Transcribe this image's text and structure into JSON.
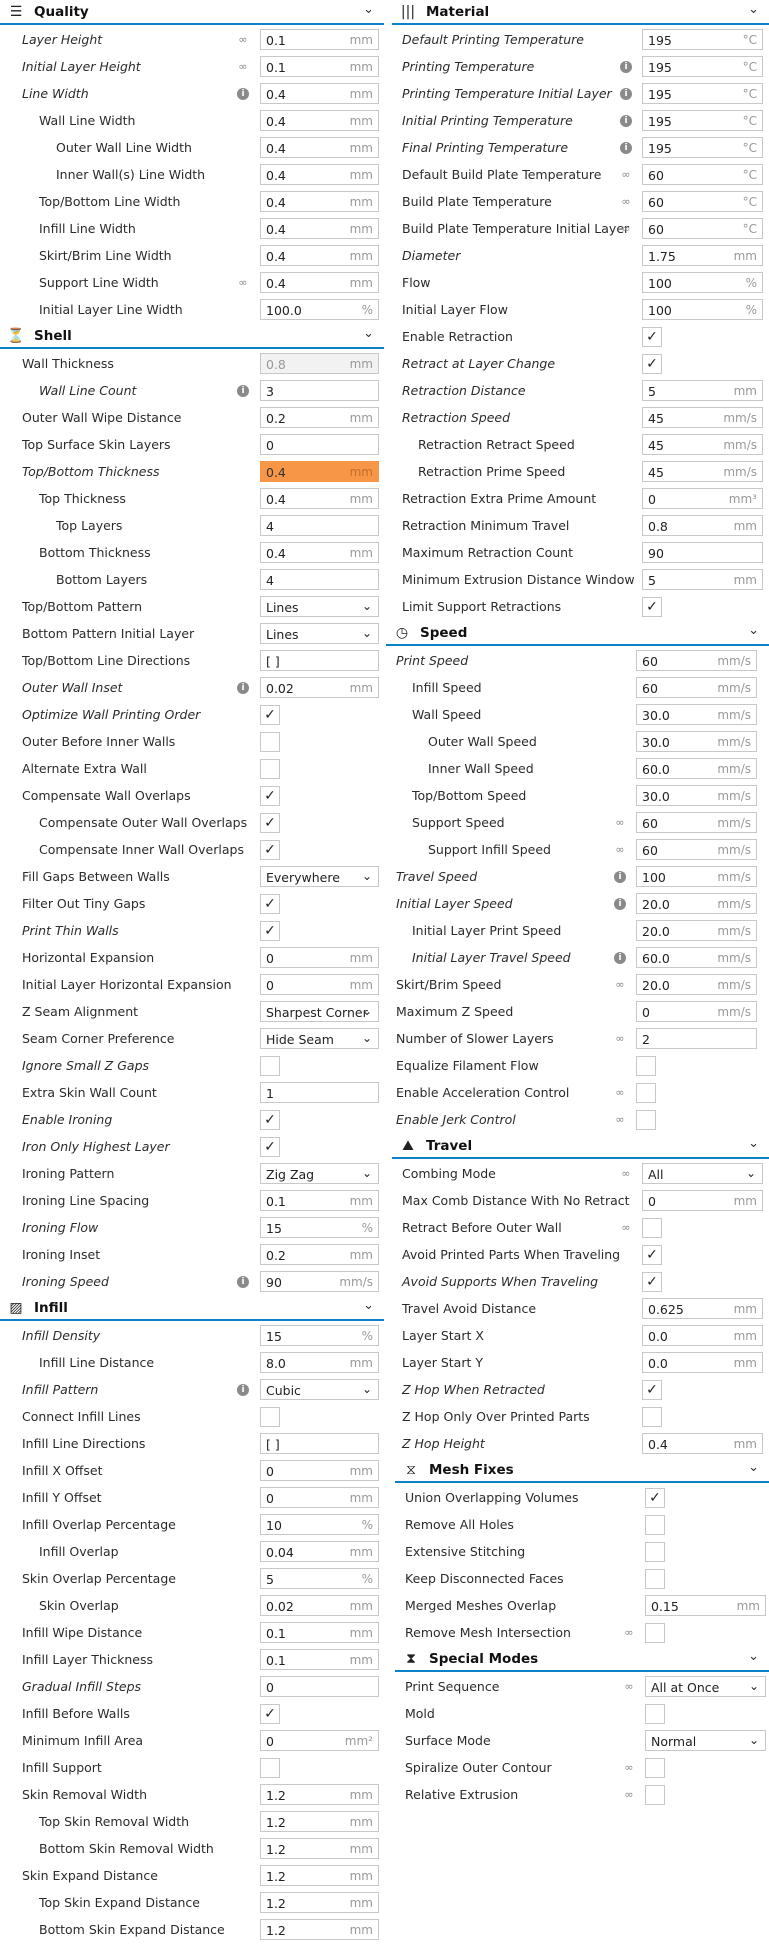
{
  "left": [
    {
      "t": "s",
      "name": "Quality",
      "icon": "quality-icon",
      "glyph": "☰"
    },
    {
      "t": "n",
      "label": "Layer Height",
      "i": 1,
      "ind": 0,
      "icon": "link",
      "val": "0.1",
      "unit": "mm"
    },
    {
      "t": "n",
      "label": "Initial Layer Height",
      "i": 1,
      "ind": 0,
      "icon": "link",
      "val": "0.1",
      "unit": "mm"
    },
    {
      "t": "n",
      "label": "Line Width",
      "i": 1,
      "ind": 0,
      "icon": "info",
      "val": "0.4",
      "unit": "mm"
    },
    {
      "t": "n",
      "label": "Wall Line Width",
      "i": 0,
      "ind": 1,
      "val": "0.4",
      "unit": "mm"
    },
    {
      "t": "n",
      "label": "Outer Wall Line Width",
      "i": 0,
      "ind": 2,
      "val": "0.4",
      "unit": "mm"
    },
    {
      "t": "n",
      "label": "Inner Wall(s) Line Width",
      "i": 0,
      "ind": 2,
      "val": "0.4",
      "unit": "mm"
    },
    {
      "t": "n",
      "label": "Top/Bottom Line Width",
      "i": 0,
      "ind": 1,
      "val": "0.4",
      "unit": "mm"
    },
    {
      "t": "n",
      "label": "Infill Line Width",
      "i": 0,
      "ind": 1,
      "val": "0.4",
      "unit": "mm"
    },
    {
      "t": "n",
      "label": "Skirt/Brim Line Width",
      "i": 0,
      "ind": 1,
      "val": "0.4",
      "unit": "mm"
    },
    {
      "t": "n",
      "label": "Support Line Width",
      "i": 0,
      "ind": 1,
      "icon": "link",
      "val": "0.4",
      "unit": "mm"
    },
    {
      "t": "n",
      "label": "Initial Layer Line Width",
      "i": 0,
      "ind": 1,
      "val": "100.0",
      "unit": "%"
    },
    {
      "t": "s",
      "name": "Shell",
      "icon": "shell-icon",
      "glyph": "⏳"
    },
    {
      "t": "n",
      "label": "Wall Thickness",
      "i": 0,
      "ind": 0,
      "val": "0.8",
      "unit": "mm",
      "st": "dis"
    },
    {
      "t": "n",
      "label": "Wall Line Count",
      "i": 1,
      "ind": 1,
      "icon": "info",
      "val": "3",
      "unit": ""
    },
    {
      "t": "n",
      "label": "Outer Wall Wipe Distance",
      "i": 0,
      "ind": 0,
      "val": "0.2",
      "unit": "mm"
    },
    {
      "t": "n",
      "label": "Top Surface Skin Layers",
      "i": 0,
      "ind": 0,
      "val": "0",
      "unit": ""
    },
    {
      "t": "n",
      "label": "Top/Bottom Thickness",
      "i": 1,
      "ind": 0,
      "val": "0.4",
      "unit": "mm",
      "st": "err"
    },
    {
      "t": "n",
      "label": "Top Thickness",
      "i": 0,
      "ind": 1,
      "val": "0.4",
      "unit": "mm"
    },
    {
      "t": "n",
      "label": "Top Layers",
      "i": 0,
      "ind": 2,
      "val": "4",
      "unit": ""
    },
    {
      "t": "n",
      "label": "Bottom Thickness",
      "i": 0,
      "ind": 1,
      "val": "0.4",
      "unit": "mm"
    },
    {
      "t": "n",
      "label": "Bottom Layers",
      "i": 0,
      "ind": 2,
      "val": "4",
      "unit": ""
    },
    {
      "t": "d",
      "label": "Top/Bottom Pattern",
      "i": 0,
      "ind": 0,
      "val": "Lines"
    },
    {
      "t": "d",
      "label": "Bottom Pattern Initial Layer",
      "i": 0,
      "ind": 0,
      "val": "Lines"
    },
    {
      "t": "n",
      "label": "Top/Bottom Line Directions",
      "i": 0,
      "ind": 0,
      "val": "[ ]",
      "unit": ""
    },
    {
      "t": "n",
      "label": "Outer Wall Inset",
      "i": 1,
      "ind": 0,
      "icon": "info",
      "val": "0.02",
      "unit": "mm"
    },
    {
      "t": "c",
      "label": "Optimize Wall Printing Order",
      "i": 1,
      "ind": 0,
      "chk": 1
    },
    {
      "t": "c",
      "label": "Outer Before Inner Walls",
      "i": 0,
      "ind": 0,
      "chk": 0
    },
    {
      "t": "c",
      "label": "Alternate Extra Wall",
      "i": 0,
      "ind": 0,
      "chk": 0
    },
    {
      "t": "c",
      "label": "Compensate Wall Overlaps",
      "i": 0,
      "ind": 0,
      "chk": 1
    },
    {
      "t": "c",
      "label": "Compensate Outer Wall Overlaps",
      "i": 0,
      "ind": 1,
      "chk": 1
    },
    {
      "t": "c",
      "label": "Compensate Inner Wall Overlaps",
      "i": 0,
      "ind": 1,
      "chk": 1
    },
    {
      "t": "d",
      "label": "Fill Gaps Between Walls",
      "i": 0,
      "ind": 0,
      "val": "Everywhere"
    },
    {
      "t": "c",
      "label": "Filter Out Tiny Gaps",
      "i": 0,
      "ind": 0,
      "chk": 1
    },
    {
      "t": "c",
      "label": "Print Thin Walls",
      "i": 1,
      "ind": 0,
      "chk": 1
    },
    {
      "t": "n",
      "label": "Horizontal Expansion",
      "i": 0,
      "ind": 0,
      "val": "0",
      "unit": "mm"
    },
    {
      "t": "n",
      "label": "Initial Layer Horizontal Expansion",
      "i": 0,
      "ind": 0,
      "val": "0",
      "unit": "mm"
    },
    {
      "t": "d",
      "label": "Z Seam Alignment",
      "i": 0,
      "ind": 0,
      "val": "Sharpest Corner"
    },
    {
      "t": "d",
      "label": "Seam Corner Preference",
      "i": 0,
      "ind": 0,
      "val": "Hide Seam"
    },
    {
      "t": "c",
      "label": "Ignore Small Z Gaps",
      "i": 1,
      "ind": 0,
      "chk": 0
    },
    {
      "t": "n",
      "label": "Extra Skin Wall Count",
      "i": 0,
      "ind": 0,
      "val": "1",
      "unit": ""
    },
    {
      "t": "c",
      "label": "Enable Ironing",
      "i": 1,
      "ind": 0,
      "chk": 1
    },
    {
      "t": "c",
      "label": "Iron Only Highest Layer",
      "i": 1,
      "ind": 0,
      "chk": 1
    },
    {
      "t": "d",
      "label": "Ironing Pattern",
      "i": 0,
      "ind": 0,
      "val": "Zig Zag"
    },
    {
      "t": "n",
      "label": "Ironing Line Spacing",
      "i": 0,
      "ind": 0,
      "val": "0.1",
      "unit": "mm"
    },
    {
      "t": "n",
      "label": "Ironing Flow",
      "i": 1,
      "ind": 0,
      "val": "15",
      "unit": "%"
    },
    {
      "t": "n",
      "label": "Ironing Inset",
      "i": 0,
      "ind": 0,
      "val": "0.2",
      "unit": "mm"
    },
    {
      "t": "n",
      "label": "Ironing Speed",
      "i": 1,
      "ind": 0,
      "icon": "info",
      "val": "90",
      "unit": "mm/s"
    },
    {
      "t": "s",
      "name": "Infill",
      "icon": "infill-icon",
      "glyph": "▨"
    },
    {
      "t": "n",
      "label": "Infill Density",
      "i": 1,
      "ind": 0,
      "val": "15",
      "unit": "%"
    },
    {
      "t": "n",
      "label": "Infill Line Distance",
      "i": 0,
      "ind": 1,
      "val": "8.0",
      "unit": "mm"
    },
    {
      "t": "d",
      "label": "Infill Pattern",
      "i": 1,
      "ind": 0,
      "icon": "info",
      "val": "Cubic"
    },
    {
      "t": "c",
      "label": "Connect Infill Lines",
      "i": 0,
      "ind": 0,
      "chk": 0
    },
    {
      "t": "n",
      "label": "Infill Line Directions",
      "i": 0,
      "ind": 0,
      "val": "[ ]",
      "unit": ""
    },
    {
      "t": "n",
      "label": "Infill X Offset",
      "i": 0,
      "ind": 0,
      "val": "0",
      "unit": "mm"
    },
    {
      "t": "n",
      "label": "Infill Y Offset",
      "i": 0,
      "ind": 0,
      "val": "0",
      "unit": "mm"
    },
    {
      "t": "n",
      "label": "Infill Overlap Percentage",
      "i": 0,
      "ind": 0,
      "val": "10",
      "unit": "%"
    },
    {
      "t": "n",
      "label": "Infill Overlap",
      "i": 0,
      "ind": 1,
      "val": "0.04",
      "unit": "mm"
    },
    {
      "t": "n",
      "label": "Skin Overlap Percentage",
      "i": 0,
      "ind": 0,
      "val": "5",
      "unit": "%"
    },
    {
      "t": "n",
      "label": "Skin Overlap",
      "i": 0,
      "ind": 1,
      "val": "0.02",
      "unit": "mm"
    },
    {
      "t": "n",
      "label": "Infill Wipe Distance",
      "i": 0,
      "ind": 0,
      "val": "0.1",
      "unit": "mm"
    },
    {
      "t": "n",
      "label": "Infill Layer Thickness",
      "i": 0,
      "ind": 0,
      "val": "0.1",
      "unit": "mm"
    },
    {
      "t": "n",
      "label": "Gradual Infill Steps",
      "i": 1,
      "ind": 0,
      "val": "0",
      "unit": ""
    },
    {
      "t": "c",
      "label": "Infill Before Walls",
      "i": 0,
      "ind": 0,
      "chk": 1
    },
    {
      "t": "n",
      "label": "Minimum Infill Area",
      "i": 0,
      "ind": 0,
      "val": "0",
      "unit": "mm²"
    },
    {
      "t": "c",
      "label": "Infill Support",
      "i": 0,
      "ind": 0,
      "chk": 0
    },
    {
      "t": "n",
      "label": "Skin Removal Width",
      "i": 0,
      "ind": 0,
      "val": "1.2",
      "unit": "mm"
    },
    {
      "t": "n",
      "label": "Top Skin Removal Width",
      "i": 0,
      "ind": 1,
      "val": "1.2",
      "unit": "mm"
    },
    {
      "t": "n",
      "label": "Bottom Skin Removal Width",
      "i": 0,
      "ind": 1,
      "val": "1.2",
      "unit": "mm"
    },
    {
      "t": "n",
      "label": "Skin Expand Distance",
      "i": 0,
      "ind": 0,
      "val": "1.2",
      "unit": "mm"
    },
    {
      "t": "n",
      "label": "Top Skin Expand Distance",
      "i": 0,
      "ind": 1,
      "val": "1.2",
      "unit": "mm"
    },
    {
      "t": "n",
      "label": "Bottom Skin Expand Distance",
      "i": 0,
      "ind": 1,
      "val": "1.2",
      "unit": "mm"
    }
  ],
  "right": [
    {
      "t": "s",
      "name": "Material",
      "icon": "material-icon",
      "glyph": "|||"
    },
    {
      "t": "n",
      "label": "Default Printing Temperature",
      "i": 1,
      "ind": 0,
      "val": "195",
      "unit": "°C"
    },
    {
      "t": "n",
      "label": "Printing Temperature",
      "i": 1,
      "ind": 0,
      "icon": "info",
      "val": "195",
      "unit": "°C"
    },
    {
      "t": "n",
      "label": "Printing Temperature Initial Layer",
      "i": 1,
      "ind": 0,
      "icon": "info",
      "val": "195",
      "unit": "°C"
    },
    {
      "t": "n",
      "label": "Initial Printing Temperature",
      "i": 1,
      "ind": 0,
      "icon": "info",
      "val": "195",
      "unit": "°C"
    },
    {
      "t": "n",
      "label": "Final Printing Temperature",
      "i": 1,
      "ind": 0,
      "icon": "info",
      "val": "195",
      "unit": "°C"
    },
    {
      "t": "n",
      "label": "Default Build Plate Temperature",
      "i": 0,
      "ind": 0,
      "icon": "link",
      "val": "60",
      "unit": "°C"
    },
    {
      "t": "n",
      "label": "Build Plate Temperature",
      "i": 0,
      "ind": 0,
      "icon": "link",
      "val": "60",
      "unit": "°C"
    },
    {
      "t": "n",
      "label": "Build Plate Temperature Initial Layer",
      "i": 0,
      "ind": 0,
      "icon": "link",
      "val": "60",
      "unit": "°C"
    },
    {
      "t": "n",
      "label": "Diameter",
      "i": 1,
      "ind": 0,
      "val": "1.75",
      "unit": "mm"
    },
    {
      "t": "n",
      "label": "Flow",
      "i": 0,
      "ind": 0,
      "val": "100",
      "unit": "%"
    },
    {
      "t": "n",
      "label": "Initial Layer Flow",
      "i": 0,
      "ind": 0,
      "val": "100",
      "unit": "%"
    },
    {
      "t": "c",
      "label": "Enable Retraction",
      "i": 0,
      "ind": 0,
      "chk": 1
    },
    {
      "t": "c",
      "label": "Retract at Layer Change",
      "i": 1,
      "ind": 0,
      "chk": 1
    },
    {
      "t": "n",
      "label": "Retraction Distance",
      "i": 1,
      "ind": 0,
      "val": "5",
      "unit": "mm"
    },
    {
      "t": "n",
      "label": "Retraction Speed",
      "i": 1,
      "ind": 0,
      "val": "45",
      "unit": "mm/s"
    },
    {
      "t": "n",
      "label": "Retraction Retract Speed",
      "i": 0,
      "ind": 1,
      "val": "45",
      "unit": "mm/s"
    },
    {
      "t": "n",
      "label": "Retraction Prime Speed",
      "i": 0,
      "ind": 1,
      "val": "45",
      "unit": "mm/s"
    },
    {
      "t": "n",
      "label": "Retraction Extra Prime Amount",
      "i": 0,
      "ind": 0,
      "val": "0",
      "unit": "mm³"
    },
    {
      "t": "n",
      "label": "Retraction Minimum Travel",
      "i": 0,
      "ind": 0,
      "val": "0.8",
      "unit": "mm"
    },
    {
      "t": "n",
      "label": "Maximum Retraction Count",
      "i": 0,
      "ind": 0,
      "val": "90",
      "unit": ""
    },
    {
      "t": "n",
      "label": "Minimum Extrusion Distance Window",
      "i": 0,
      "ind": 0,
      "val": "5",
      "unit": "mm"
    },
    {
      "t": "c",
      "label": "Limit Support Retractions",
      "i": 0,
      "ind": 0,
      "chk": 1
    },
    {
      "t": "s",
      "name": "Speed",
      "icon": "speed-icon",
      "glyph": "◷",
      "x": -6
    },
    {
      "t": "n",
      "label": "Print Speed",
      "i": 1,
      "ind": 0,
      "val": "60",
      "unit": "mm/s",
      "x": -6
    },
    {
      "t": "n",
      "label": "Infill Speed",
      "i": 0,
      "ind": 1,
      "val": "60",
      "unit": "mm/s",
      "x": -6
    },
    {
      "t": "n",
      "label": "Wall Speed",
      "i": 0,
      "ind": 1,
      "val": "30.0",
      "unit": "mm/s",
      "x": -6
    },
    {
      "t": "n",
      "label": "Outer Wall Speed",
      "i": 0,
      "ind": 2,
      "val": "30.0",
      "unit": "mm/s",
      "x": -6
    },
    {
      "t": "n",
      "label": "Inner Wall Speed",
      "i": 0,
      "ind": 2,
      "val": "60.0",
      "unit": "mm/s",
      "x": -6
    },
    {
      "t": "n",
      "label": "Top/Bottom Speed",
      "i": 0,
      "ind": 1,
      "val": "30.0",
      "unit": "mm/s",
      "x": -6
    },
    {
      "t": "n",
      "label": "Support Speed",
      "i": 0,
      "ind": 1,
      "icon": "link",
      "val": "60",
      "unit": "mm/s",
      "x": -6
    },
    {
      "t": "n",
      "label": "Support Infill Speed",
      "i": 0,
      "ind": 2,
      "icon": "link",
      "val": "60",
      "unit": "mm/s",
      "x": -6
    },
    {
      "t": "n",
      "label": "Travel Speed",
      "i": 1,
      "ind": 0,
      "icon": "info",
      "val": "100",
      "unit": "mm/s",
      "x": -6
    },
    {
      "t": "n",
      "label": "Initial Layer Speed",
      "i": 1,
      "ind": 0,
      "icon": "info",
      "val": "20.0",
      "unit": "mm/s",
      "x": -6
    },
    {
      "t": "n",
      "label": "Initial Layer Print Speed",
      "i": 0,
      "ind": 1,
      "val": "20.0",
      "unit": "mm/s",
      "x": -6
    },
    {
      "t": "n",
      "label": "Initial Layer Travel Speed",
      "i": 1,
      "ind": 1,
      "icon": "info",
      "val": "60.0",
      "unit": "mm/s",
      "x": -6
    },
    {
      "t": "n",
      "label": "Skirt/Brim Speed",
      "i": 0,
      "ind": 0,
      "icon": "link",
      "val": "20.0",
      "unit": "mm/s",
      "x": -6
    },
    {
      "t": "n",
      "label": "Maximum Z Speed",
      "i": 0,
      "ind": 0,
      "val": "0",
      "unit": "mm/s",
      "x": -6
    },
    {
      "t": "n",
      "label": "Number of Slower Layers",
      "i": 0,
      "ind": 0,
      "icon": "link",
      "val": "2",
      "unit": "",
      "x": -6
    },
    {
      "t": "c",
      "label": "Equalize Filament Flow",
      "i": 0,
      "ind": 0,
      "chk": 0,
      "x": -6
    },
    {
      "t": "c",
      "label": "Enable Acceleration Control",
      "i": 0,
      "ind": 0,
      "icon": "link",
      "chk": 0,
      "x": -6
    },
    {
      "t": "c",
      "label": "Enable Jerk Control",
      "i": 1,
      "ind": 0,
      "icon": "link",
      "chk": 0,
      "x": -6
    },
    {
      "t": "s",
      "name": "Travel",
      "icon": "travel-icon",
      "glyph": "⛰"
    },
    {
      "t": "d",
      "label": "Combing Mode",
      "i": 0,
      "ind": 0,
      "icon": "link",
      "val": "All"
    },
    {
      "t": "n",
      "label": "Max Comb Distance With No Retract",
      "i": 0,
      "ind": 0,
      "val": "0",
      "unit": "mm"
    },
    {
      "t": "c",
      "label": "Retract Before Outer Wall",
      "i": 0,
      "ind": 0,
      "icon": "link",
      "chk": 0
    },
    {
      "t": "c",
      "label": "Avoid Printed Parts When Traveling",
      "i": 0,
      "ind": 0,
      "chk": 1
    },
    {
      "t": "c",
      "label": "Avoid Supports When Traveling",
      "i": 1,
      "ind": 0,
      "chk": 1
    },
    {
      "t": "n",
      "label": "Travel Avoid Distance",
      "i": 0,
      "ind": 0,
      "val": "0.625",
      "unit": "mm"
    },
    {
      "t": "n",
      "label": "Layer Start X",
      "i": 0,
      "ind": 0,
      "val": "0.0",
      "unit": "mm"
    },
    {
      "t": "n",
      "label": "Layer Start Y",
      "i": 0,
      "ind": 0,
      "val": "0.0",
      "unit": "mm"
    },
    {
      "t": "c",
      "label": "Z Hop When Retracted",
      "i": 1,
      "ind": 0,
      "chk": 1
    },
    {
      "t": "c",
      "label": "Z Hop Only Over Printed Parts",
      "i": 0,
      "ind": 0,
      "chk": 0
    },
    {
      "t": "n",
      "label": "Z Hop Height",
      "i": 1,
      "ind": 0,
      "val": "0.4",
      "unit": "mm"
    },
    {
      "t": "s",
      "name": "Mesh Fixes",
      "icon": "mesh-fixes-icon",
      "glyph": "⧖",
      "x": 3
    },
    {
      "t": "c",
      "label": "Union Overlapping Volumes",
      "i": 0,
      "ind": 0,
      "chk": 1,
      "x": 3
    },
    {
      "t": "c",
      "label": "Remove All Holes",
      "i": 0,
      "ind": 0,
      "chk": 0,
      "x": 3
    },
    {
      "t": "c",
      "label": "Extensive Stitching",
      "i": 0,
      "ind": 0,
      "chk": 0,
      "x": 3
    },
    {
      "t": "c",
      "label": "Keep Disconnected Faces",
      "i": 0,
      "ind": 0,
      "chk": 0,
      "x": 3
    },
    {
      "t": "n",
      "label": "Merged Meshes Overlap",
      "i": 0,
      "ind": 0,
      "val": "0.15",
      "unit": "mm",
      "x": 3
    },
    {
      "t": "c",
      "label": "Remove Mesh Intersection",
      "i": 0,
      "ind": 0,
      "icon": "link",
      "chk": 0,
      "x": 3
    },
    {
      "t": "s",
      "name": "Special Modes",
      "icon": "special-modes-icon",
      "glyph": "⧗",
      "x": 3
    },
    {
      "t": "d",
      "label": "Print Sequence",
      "i": 0,
      "ind": 0,
      "icon": "link",
      "val": "All at Once",
      "x": 3
    },
    {
      "t": "c",
      "label": "Mold",
      "i": 0,
      "ind": 0,
      "chk": 0,
      "x": 3
    },
    {
      "t": "d",
      "label": "Surface Mode",
      "i": 0,
      "ind": 0,
      "val": "Normal",
      "x": 3
    },
    {
      "t": "c",
      "label": "Spiralize Outer Contour",
      "i": 0,
      "ind": 0,
      "icon": "link",
      "chk": 0,
      "x": 3
    },
    {
      "t": "c",
      "label": "Relative Extrusion",
      "i": 0,
      "ind": 0,
      "icon": "link",
      "chk": 0,
      "x": 3
    }
  ]
}
